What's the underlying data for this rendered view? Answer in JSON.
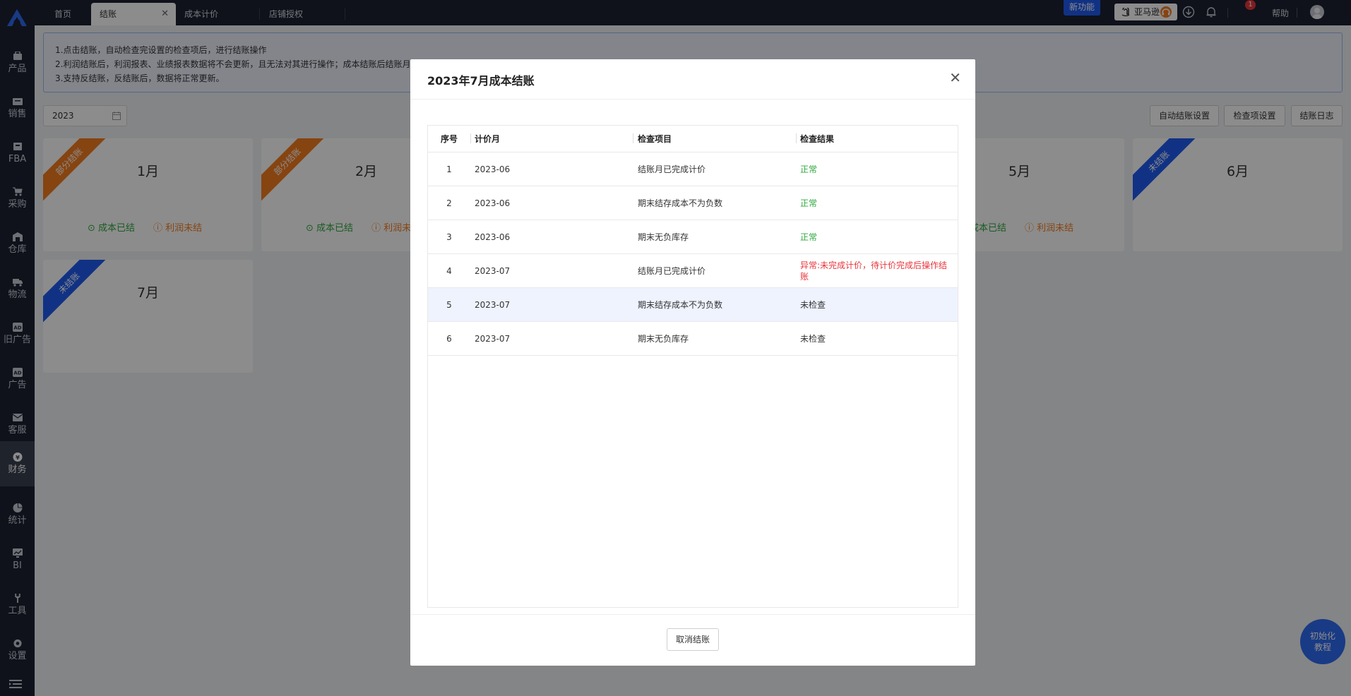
{
  "sidebar": {
    "items": [
      {
        "label": "产品",
        "icon": "product-icon"
      },
      {
        "label": "销售",
        "icon": "sales-icon"
      },
      {
        "label": "FBA",
        "icon": "fba-icon"
      },
      {
        "label": "采购",
        "icon": "cart-icon"
      },
      {
        "label": "仓库",
        "icon": "warehouse-icon"
      },
      {
        "label": "物流",
        "icon": "truck-icon"
      },
      {
        "label": "旧广告",
        "icon": "ad-icon"
      },
      {
        "label": "广告",
        "icon": "ad-icon"
      },
      {
        "label": "客服",
        "icon": "mail-icon"
      },
      {
        "label": "财务",
        "icon": "finance-icon"
      },
      {
        "label": "统计",
        "icon": "pie-icon"
      },
      {
        "label": "BI",
        "icon": "bi-icon"
      },
      {
        "label": "工具",
        "icon": "tool-icon"
      },
      {
        "label": "设置",
        "icon": "gear-icon"
      }
    ],
    "active": "财务"
  },
  "topbar": {
    "tabs": [
      {
        "label": "首页"
      },
      {
        "label": "结账",
        "active": true
      },
      {
        "label": "成本计价"
      },
      {
        "label": "店铺授权"
      }
    ],
    "new_feature": "新功能",
    "marketplace": "亚马逊",
    "notification_count": "1",
    "help": "帮助"
  },
  "notice": {
    "lines": [
      "1.点击结账，自动检查完设置的检查项后，进行结账操作",
      "2.利润结账后，利润报表、业绩报表数据将不会更新，且无法对其进行操作；成本结账后结账月",
      "3.支持反结账，反结账后，数据将正常更新。"
    ]
  },
  "filters": {
    "year": "2023"
  },
  "toolbar": {
    "auto_settle": "自动结账设置",
    "check_settings": "检查项设置",
    "settle_log": "结账日志"
  },
  "cards": {
    "jan": {
      "month": "1月",
      "ribbon": "部分结账",
      "cost": "成本已结",
      "profit": "利润未结"
    },
    "feb": {
      "month": "2月",
      "ribbon": "部分结账",
      "cost": "成本已结",
      "profit": "利润未"
    },
    "may": {
      "month": "5月",
      "cost": "成本已结",
      "profit": "利润未结"
    },
    "jun": {
      "month": "6月",
      "ribbon": "未结账"
    },
    "jul": {
      "month": "7月",
      "ribbon": "未结账"
    }
  },
  "fab": {
    "line1": "初始化",
    "line2": "教程"
  },
  "modal": {
    "title": "2023年7月成本结账",
    "columns": [
      "序号",
      "计价月",
      "检查项目",
      "检查结果"
    ],
    "rows": [
      {
        "idx": "1",
        "month": "2023-06",
        "item": "结账月已完成计价",
        "result": "正常",
        "status": "ok"
      },
      {
        "idx": "2",
        "month": "2023-06",
        "item": "期末结存成本不为负数",
        "result": "正常",
        "status": "ok"
      },
      {
        "idx": "3",
        "month": "2023-06",
        "item": "期末无负库存",
        "result": "正常",
        "status": "ok"
      },
      {
        "idx": "4",
        "month": "2023-07",
        "item": "结账月已完成计价",
        "result": "异常:未完成计价，待计价完成后操作结账",
        "status": "error"
      },
      {
        "idx": "5",
        "month": "2023-07",
        "item": "期末结存成本不为负数",
        "result": "未检查",
        "status": "pending"
      },
      {
        "idx": "6",
        "month": "2023-07",
        "item": "期末无负库存",
        "result": "未检查",
        "status": "pending"
      }
    ],
    "cancel": "取消结账"
  },
  "colors": {
    "brand": "#1f5cf0",
    "sidebar": "#1c2232",
    "ok": "#2ea83d",
    "warn": "#f57c1f",
    "error": "#e8353b"
  }
}
